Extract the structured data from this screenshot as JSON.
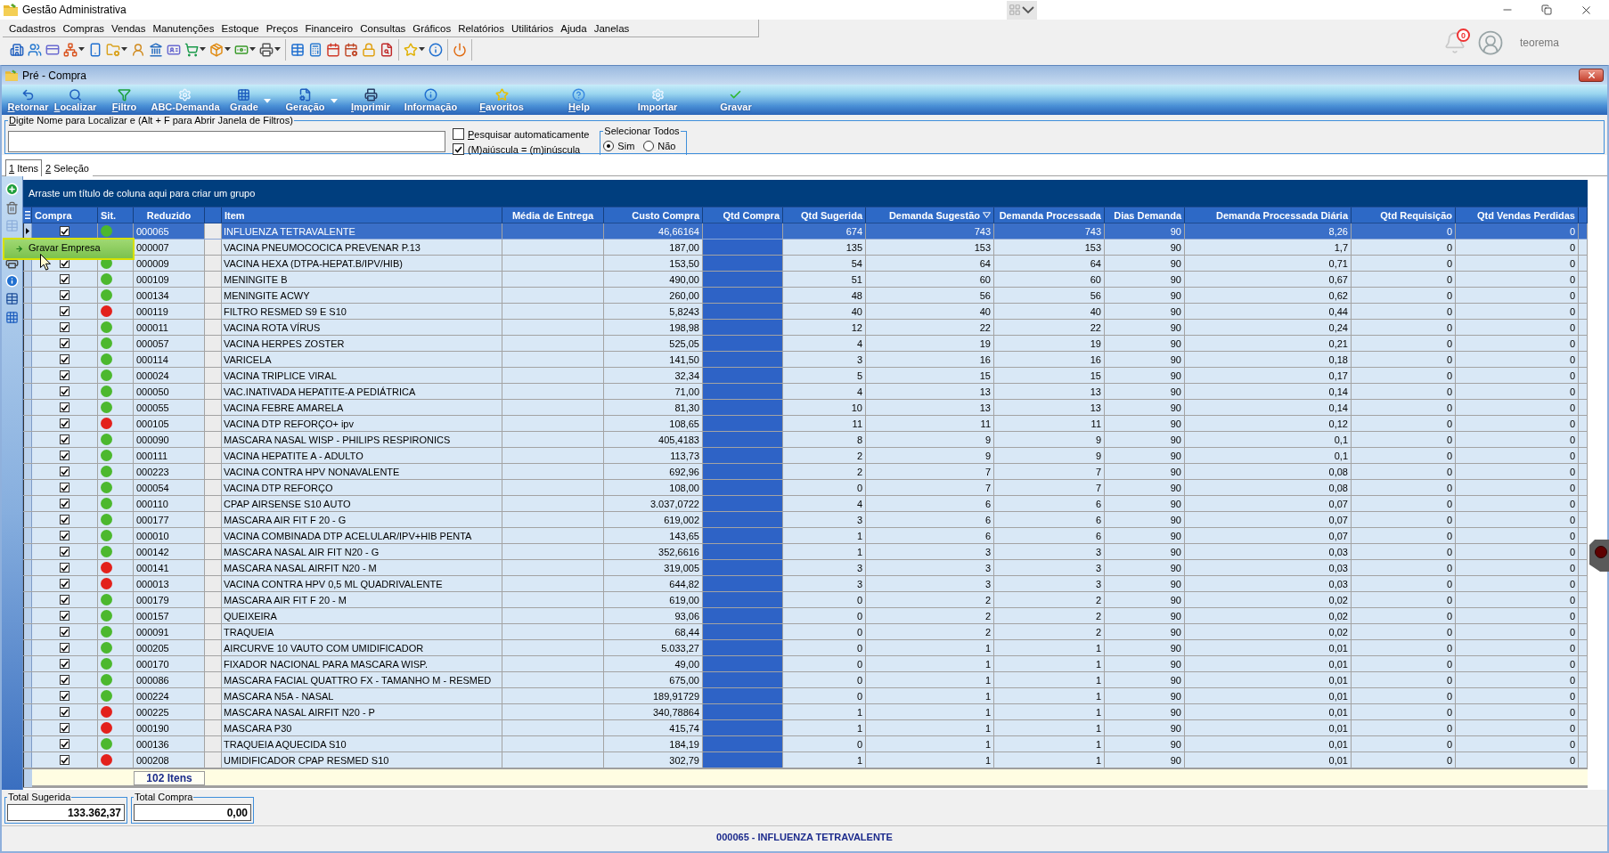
{
  "window": {
    "title": "Gestão Administrativa"
  },
  "menu": [
    "Cadastros",
    "Compras",
    "Vendas",
    "Manutenções",
    "Estoque",
    "Preços",
    "Financeiro",
    "Consultas",
    "Gráficos",
    "Relatórios",
    "Utilitários",
    "Ajuda",
    "Janelas"
  ],
  "user": {
    "name": "teorema",
    "notifications": "0"
  },
  "document": {
    "title": "Pré - Compra"
  },
  "ribbon": [
    {
      "label": "Retornar",
      "mnemonic": true,
      "dropdown": false
    },
    {
      "label": "Localizar",
      "mnemonic": true,
      "dropdown": false
    },
    {
      "label": "Filtro",
      "mnemonic": true,
      "dropdown": false
    },
    {
      "label": "ABC-Demanda",
      "mnemonic": false,
      "dropdown": false
    },
    {
      "label": "Grade",
      "mnemonic": false,
      "dropdown": true
    },
    {
      "label": "Geração",
      "mnemonic": false,
      "dropdown": true
    },
    {
      "label": "Imprimir",
      "mnemonic": true,
      "dropdown": false
    },
    {
      "label": "Informação",
      "mnemonic": false,
      "dropdown": false
    },
    {
      "label": "Favoritos",
      "mnemonic": true,
      "dropdown": false
    },
    {
      "label": "Help",
      "mnemonic": true,
      "dropdown": false
    },
    {
      "label": "Importar",
      "mnemonic": false,
      "dropdown": false
    },
    {
      "label": "Gravar",
      "mnemonic": false,
      "dropdown": false
    }
  ],
  "search": {
    "legend": "Digite Nome para Localizar e (Alt + F para Abrir Janela de Filtros)",
    "mnemonic": true,
    "options": [
      {
        "label": "Pesquisar automaticamente",
        "checked": false,
        "mnemonic": true
      },
      {
        "label": "(M)aiúscula = (m)inúscula",
        "checked": true,
        "mnemonic": false
      }
    ],
    "select_all": {
      "legend": "Selecionar Todos",
      "options": [
        {
          "label": "Sim",
          "selected": true
        },
        {
          "label": "Não",
          "selected": false
        }
      ]
    }
  },
  "tabs": [
    {
      "label": "1 Itens",
      "selected": true,
      "mnemonic": true
    },
    {
      "label": "2 Seleção",
      "selected": false,
      "mnemonic": true
    }
  ],
  "context_menu": {
    "items": [
      {
        "label": "Gravar Empresa",
        "selected": true
      }
    ]
  },
  "grid": {
    "group_hint": "Arraste um título de coluna aqui para criar um grupo",
    "columns": [
      {
        "kind": "check",
        "label": "Compra",
        "sorted": false
      },
      {
        "kind": "status",
        "label": "Sit.",
        "sorted": false
      },
      {
        "kind": "code",
        "label": "Reduzido",
        "sorted": false
      },
      {
        "kind": "spacer"
      },
      {
        "kind": "text",
        "label": "Item",
        "sorted": false
      },
      {
        "kind": "empty",
        "label": "Média de Entrega",
        "sorted": false
      },
      {
        "kind": "cost",
        "label": "Custo Compra",
        "sorted": false
      },
      {
        "kind": "entry",
        "label": "Qtd Compra",
        "sorted": false
      },
      {
        "kind": "number",
        "label": "Qtd Sugerida",
        "sorted": false
      },
      {
        "kind": "number",
        "label": "Demanda Sugestão",
        "sorted": true
      },
      {
        "kind": "number",
        "label": "Demanda Processada",
        "sorted": false
      },
      {
        "kind": "number",
        "label": "Dias Demanda",
        "sorted": false
      },
      {
        "kind": "number",
        "label": "Demanda Processada Diária",
        "sorted": false
      },
      {
        "kind": "number",
        "label": "Qtd Requisição",
        "sorted": false
      },
      {
        "kind": "number",
        "label": "Qtd Vendas Perdidas",
        "sorted": false
      }
    ],
    "rows": [
      {
        "selected": true,
        "checked": true,
        "color": "#4cb82e",
        "code": "000065",
        "item": "INFLUENZA TETRAVALENTE",
        "cost": "46,66164",
        "numbers": [
          "674",
          "743",
          "743",
          "90",
          "8,26",
          "0",
          "0"
        ]
      },
      {
        "selected": false,
        "code": "000007",
        "item": "VACINA PNEUMOCOCICA PREVENAR P.13",
        "cost": "187,00",
        "numbers": [
          "135",
          "153",
          "153",
          "90",
          "1,7",
          "0",
          "0"
        ]
      },
      {
        "selected": false,
        "checked": true,
        "color": "#4cb82e",
        "code": "000009",
        "item": "VACINA HEXA (DTPA-HEPAT.B/IPV/HIB)",
        "cost": "153,50",
        "numbers": [
          "54",
          "64",
          "64",
          "90",
          "0,71",
          "0",
          "0"
        ]
      },
      {
        "selected": false,
        "checked": true,
        "color": "#4cb82e",
        "code": "000109",
        "item": "MENINGITE B",
        "cost": "490,00",
        "numbers": [
          "51",
          "60",
          "60",
          "90",
          "0,67",
          "0",
          "0"
        ]
      },
      {
        "selected": false,
        "checked": true,
        "color": "#4cb82e",
        "code": "000134",
        "item": "MENINGITE ACWY",
        "cost": "260,00",
        "numbers": [
          "48",
          "56",
          "56",
          "90",
          "0,62",
          "0",
          "0"
        ]
      },
      {
        "selected": false,
        "checked": true,
        "color": "#e3211c",
        "code": "000119",
        "item": "FILTRO RESMED S9 E S10",
        "cost": "5,8243",
        "numbers": [
          "40",
          "40",
          "40",
          "90",
          "0,44",
          "0",
          "0"
        ]
      },
      {
        "selected": false,
        "checked": true,
        "color": "#4cb82e",
        "code": "000011",
        "item": "VACINA ROTA VÍRUS",
        "cost": "198,98",
        "numbers": [
          "12",
          "22",
          "22",
          "90",
          "0,24",
          "0",
          "0"
        ]
      },
      {
        "selected": false,
        "checked": true,
        "color": "#4cb82e",
        "code": "000057",
        "item": "VACINA HERPES ZOSTER",
        "cost": "525,05",
        "numbers": [
          "4",
          "19",
          "19",
          "90",
          "0,21",
          "0",
          "0"
        ]
      },
      {
        "selected": false,
        "checked": true,
        "color": "#4cb82e",
        "code": "000114",
        "item": "VARICELA",
        "cost": "141,50",
        "numbers": [
          "3",
          "16",
          "16",
          "90",
          "0,18",
          "0",
          "0"
        ]
      },
      {
        "selected": false,
        "checked": true,
        "color": "#4cb82e",
        "code": "000024",
        "item": "VACINA TRIPLICE VIRAL",
        "cost": "32,34",
        "numbers": [
          "5",
          "15",
          "15",
          "90",
          "0,17",
          "0",
          "0"
        ]
      },
      {
        "selected": false,
        "checked": true,
        "color": "#4cb82e",
        "code": "000050",
        "item": "VAC.INATIVADA HEPATITE-A PEDIÁTRICA",
        "cost": "71,00",
        "numbers": [
          "4",
          "13",
          "13",
          "90",
          "0,14",
          "0",
          "0"
        ]
      },
      {
        "selected": false,
        "checked": true,
        "color": "#4cb82e",
        "code": "000055",
        "item": "VACINA FEBRE AMARELA",
        "cost": "81,30",
        "numbers": [
          "10",
          "13",
          "13",
          "90",
          "0,14",
          "0",
          "0"
        ]
      },
      {
        "selected": false,
        "checked": true,
        "color": "#e3211c",
        "code": "000105",
        "item": "VACINA DTP REFORÇO+ ipv",
        "cost": "108,65",
        "numbers": [
          "11",
          "11",
          "11",
          "90",
          "0,12",
          "0",
          "0"
        ]
      },
      {
        "selected": false,
        "checked": true,
        "color": "#4cb82e",
        "code": "000090",
        "item": "MASCARA NASAL WISP - PHILIPS RESPIRONICS",
        "cost": "405,4183",
        "numbers": [
          "8",
          "9",
          "9",
          "90",
          "0,1",
          "0",
          "0"
        ]
      },
      {
        "selected": false,
        "checked": true,
        "color": "#4cb82e",
        "code": "000111",
        "item": "VACINA HEPATITE A - ADULTO",
        "cost": "113,73",
        "numbers": [
          "2",
          "9",
          "9",
          "90",
          "0,1",
          "0",
          "0"
        ]
      },
      {
        "selected": false,
        "checked": true,
        "color": "#4cb82e",
        "code": "000223",
        "item": "VACINA CONTRA HPV NONAVALENTE",
        "cost": "692,96",
        "numbers": [
          "2",
          "7",
          "7",
          "90",
          "0,08",
          "0",
          "0"
        ]
      },
      {
        "selected": false,
        "checked": true,
        "color": "#4cb82e",
        "code": "000054",
        "item": "VACINA DTP REFORÇO",
        "cost": "108,00",
        "numbers": [
          "0",
          "7",
          "7",
          "90",
          "0,08",
          "0",
          "0"
        ]
      },
      {
        "selected": false,
        "checked": true,
        "color": "#4cb82e",
        "code": "000110",
        "item": "CPAP AIRSENSE S10 AUTO",
        "cost": "3.037,0722",
        "numbers": [
          "4",
          "6",
          "6",
          "90",
          "0,07",
          "0",
          "0"
        ]
      },
      {
        "selected": false,
        "checked": true,
        "color": "#4cb82e",
        "code": "000177",
        "item": "MASCARA AIR FIT F 20 - G",
        "cost": "619,002",
        "numbers": [
          "3",
          "6",
          "6",
          "90",
          "0,07",
          "0",
          "0"
        ]
      },
      {
        "selected": false,
        "checked": true,
        "color": "#4cb82e",
        "code": "000010",
        "item": "VACINA COMBINADA DTP ACELULAR/IPV+HIB PENTA",
        "cost": "143,65",
        "numbers": [
          "1",
          "6",
          "6",
          "90",
          "0,07",
          "0",
          "0"
        ]
      },
      {
        "selected": false,
        "checked": true,
        "color": "#4cb82e",
        "code": "000142",
        "item": "MASCARA NASAL AIR FIT N20 - G",
        "cost": "352,6616",
        "numbers": [
          "1",
          "3",
          "3",
          "90",
          "0,03",
          "0",
          "0"
        ]
      },
      {
        "selected": false,
        "checked": true,
        "color": "#e3211c",
        "code": "000141",
        "item": "MASCARA NASAL AIRFIT N20 - M",
        "cost": "319,005",
        "numbers": [
          "3",
          "3",
          "3",
          "90",
          "0,03",
          "0",
          "0"
        ]
      },
      {
        "selected": false,
        "checked": true,
        "color": "#e3211c",
        "code": "000013",
        "item": "VACINA CONTRA HPV 0,5 ML QUADRIVALENTE",
        "cost": "644,82",
        "numbers": [
          "3",
          "3",
          "3",
          "90",
          "0,03",
          "0",
          "0"
        ]
      },
      {
        "selected": false,
        "checked": true,
        "color": "#4cb82e",
        "code": "000179",
        "item": "MASCARA AIR FIT F 20 - M",
        "cost": "619,00",
        "numbers": [
          "0",
          "2",
          "2",
          "90",
          "0,02",
          "0",
          "0"
        ]
      },
      {
        "selected": false,
        "checked": true,
        "color": "#4cb82e",
        "code": "000157",
        "item": "QUEIXEIRA",
        "cost": "93,06",
        "numbers": [
          "0",
          "2",
          "2",
          "90",
          "0,02",
          "0",
          "0"
        ]
      },
      {
        "selected": false,
        "checked": true,
        "color": "#4cb82e",
        "code": "000091",
        "item": "TRAQUEIA",
        "cost": "68,44",
        "numbers": [
          "0",
          "2",
          "2",
          "90",
          "0,02",
          "0",
          "0"
        ]
      },
      {
        "selected": false,
        "checked": true,
        "color": "#4cb82e",
        "code": "000205",
        "item": "AIRCURVE 10 VAUTO COM UMIDIFICADOR",
        "cost": "5.033,27",
        "numbers": [
          "0",
          "1",
          "1",
          "90",
          "0,01",
          "0",
          "0"
        ]
      },
      {
        "selected": false,
        "checked": true,
        "color": "#4cb82e",
        "code": "000170",
        "item": "FIXADOR NACIONAL PARA MASCARA WISP.",
        "cost": "49,00",
        "numbers": [
          "0",
          "1",
          "1",
          "90",
          "0,01",
          "0",
          "0"
        ]
      },
      {
        "selected": false,
        "checked": true,
        "color": "#4cb82e",
        "code": "000086",
        "item": "MASCARA FACIAL QUATTRO FX - TAMANHO M - RESMED",
        "cost": "675,00",
        "numbers": [
          "0",
          "1",
          "1",
          "90",
          "0,01",
          "0",
          "0"
        ]
      },
      {
        "selected": false,
        "checked": true,
        "color": "#4cb82e",
        "code": "000224",
        "item": "MASCARA N5A - NASAL",
        "cost": "189,91729",
        "numbers": [
          "0",
          "1",
          "1",
          "90",
          "0,01",
          "0",
          "0"
        ]
      },
      {
        "selected": false,
        "checked": true,
        "color": "#e3211c",
        "code": "000225",
        "item": "MASCARA NASAL AIRFIT N20 - P",
        "cost": "340,78864",
        "numbers": [
          "1",
          "1",
          "1",
          "90",
          "0,01",
          "0",
          "0"
        ]
      },
      {
        "selected": false,
        "checked": true,
        "color": "#e3211c",
        "code": "000190",
        "item": "MASCARA P30",
        "cost": "415,74",
        "numbers": [
          "1",
          "1",
          "1",
          "90",
          "0,01",
          "0",
          "0"
        ]
      },
      {
        "selected": false,
        "checked": true,
        "color": "#4cb82e",
        "code": "000136",
        "item": "TRAQUEIA AQUECIDA S10",
        "cost": "184,19",
        "numbers": [
          "0",
          "1",
          "1",
          "90",
          "0,01",
          "0",
          "0"
        ]
      },
      {
        "selected": false,
        "checked": true,
        "color": "#e3211c",
        "code": "000208",
        "item": "UMIDIFICADOR CPAP RESMED S10",
        "cost": "302,79",
        "numbers": [
          "1",
          "1",
          "1",
          "90",
          "0,01",
          "0",
          "0"
        ]
      }
    ],
    "footer": {
      "count": "102 Itens"
    }
  },
  "totals": [
    {
      "label": "Total Sugerida",
      "value": "133.362,37"
    },
    {
      "label": "Total Compra",
      "value": "0,00"
    }
  ],
  "status_bar": {
    "text": "000065 - INFLUENZA TETRAVALENTE"
  }
}
